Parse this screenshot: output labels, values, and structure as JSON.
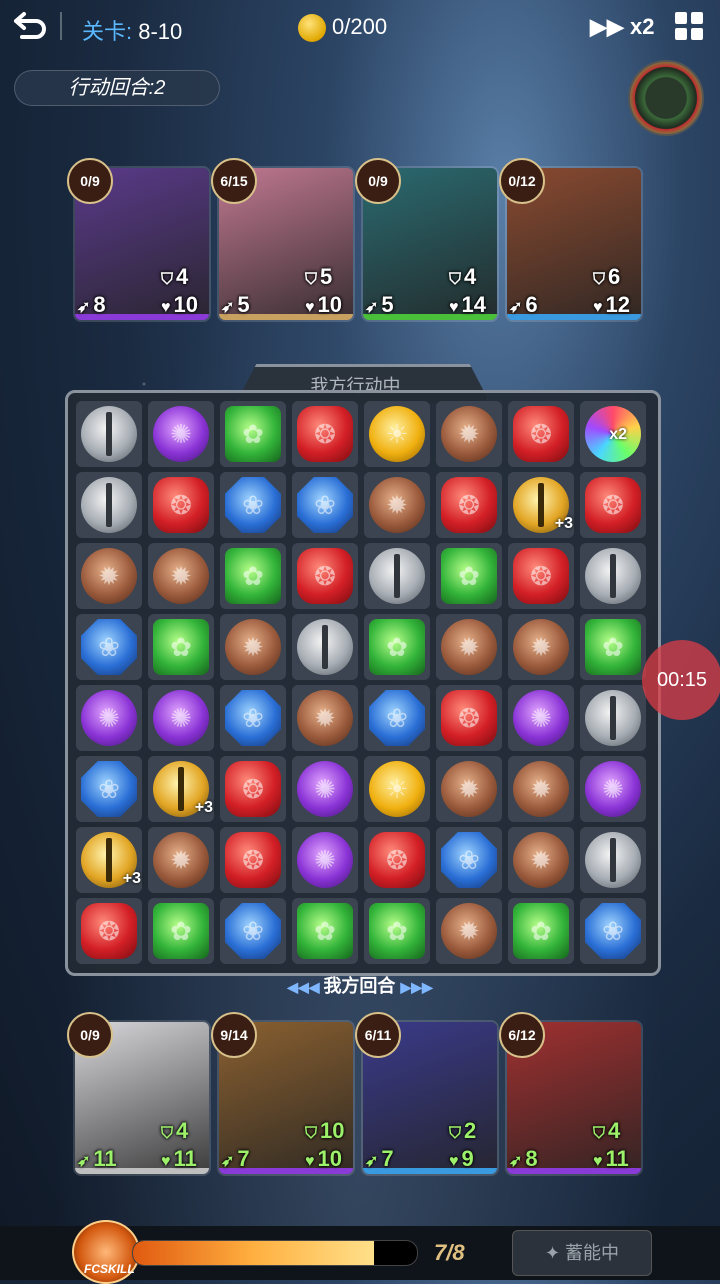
{
  "header": {
    "stage_label": "关卡:",
    "stage_value": "8-10",
    "coins": "0/200",
    "speed": "x2",
    "action_rounds": "行动回合:2"
  },
  "board": {
    "banner": "我方行动中...",
    "footer": "我方回合",
    "rows": [
      [
        "sword",
        "purple",
        "green",
        "red",
        "gold",
        "brown",
        "red",
        "rainbow"
      ],
      [
        "sword",
        "red",
        "blue",
        "blue",
        "brown",
        "red",
        "gsword",
        "red"
      ],
      [
        "brown",
        "brown",
        "green",
        "red",
        "sword",
        "green",
        "red",
        "sword"
      ],
      [
        "blue",
        "green",
        "brown",
        "sword",
        "green",
        "brown",
        "brown",
        "green"
      ],
      [
        "purple",
        "purple",
        "blue",
        "brown",
        "blue",
        "red",
        "purple",
        "sword"
      ],
      [
        "blue",
        "gsword",
        "red",
        "purple",
        "gold",
        "brown",
        "brown",
        "purple"
      ],
      [
        "gsword",
        "brown",
        "red",
        "purple",
        "red",
        "blue",
        "brown",
        "sword"
      ],
      [
        "red",
        "green",
        "blue",
        "green",
        "green",
        "brown",
        "green",
        "blue"
      ]
    ],
    "labels": {
      "0-7": "x2",
      "1-6": "+3",
      "5-1": "+3",
      "6-0": "+3"
    }
  },
  "timer": "00:15",
  "enemies": [
    {
      "charge": "0/9",
      "shield": "4",
      "attack": "8",
      "hp": "10",
      "bar": "#8a3ad6",
      "art": "#5a3a8a"
    },
    {
      "charge": "6/15",
      "shield": "5",
      "attack": "5",
      "hp": "10",
      "bar": "#c8a060",
      "art": "#c07890"
    },
    {
      "charge": "0/9",
      "shield": "4",
      "attack": "5",
      "hp": "14",
      "bar": "#4ac03a",
      "art": "#2a6a70"
    },
    {
      "charge": "0/12",
      "shield": "6",
      "attack": "6",
      "hp": "12",
      "bar": "#3a9ae0",
      "art": "#8a4a30"
    }
  ],
  "allies": [
    {
      "charge": "0/9",
      "shield": "4",
      "attack": "11",
      "hp": "11",
      "bar": "#bfbfbf",
      "art": "#d8d8dc"
    },
    {
      "charge": "9/14",
      "shield": "10",
      "attack": "7",
      "hp": "10",
      "bar": "#8a3ad6",
      "art": "#8a6030"
    },
    {
      "charge": "6/11",
      "shield": "2",
      "attack": "7",
      "hp": "9",
      "bar": "#3a9ae0",
      "art": "#3a3a8a"
    },
    {
      "charge": "6/12",
      "shield": "4",
      "attack": "8",
      "hp": "11",
      "bar": "#8a3ad6",
      "art": "#a03030"
    }
  ],
  "skill": {
    "label": "FCSKILL",
    "energy": "7/8",
    "energy_fraction": 0.85,
    "charge_button": "蓄能中"
  },
  "icons": {
    "back": "back-arrow-icon",
    "menu": "grid-menu-icon",
    "coin": "coin-icon",
    "fast_forward": "fast-forward-icon"
  }
}
